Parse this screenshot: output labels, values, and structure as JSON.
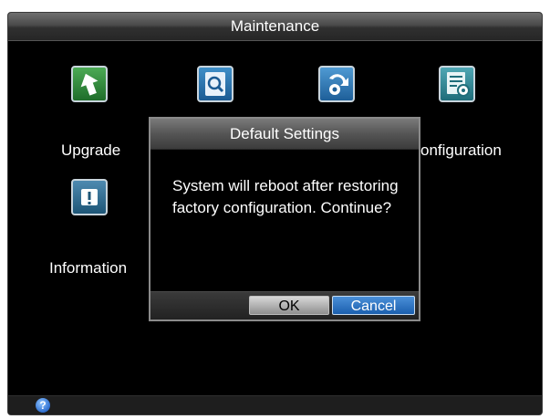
{
  "window": {
    "title": "Maintenance"
  },
  "menu_items": [
    {
      "label": "Upgrade",
      "icon": "upgrade-arrow-icon"
    },
    {
      "label": "",
      "icon": "log-search-icon"
    },
    {
      "label": "",
      "icon": "restore-gear-icon"
    },
    {
      "label": "onfiguration",
      "icon": "configuration-icon"
    },
    {
      "label": "Information",
      "icon": "information-icon"
    }
  ],
  "dialog": {
    "title": "Default Settings",
    "message": "System will reboot after restoring factory configuration. Continue?",
    "ok_label": "OK",
    "cancel_label": "Cancel"
  },
  "statusbar": {
    "help_glyph": "?"
  },
  "colors": {
    "background": "#000000",
    "cancel_button": "#1b5fae",
    "ok_button": "#c8c8c8"
  }
}
